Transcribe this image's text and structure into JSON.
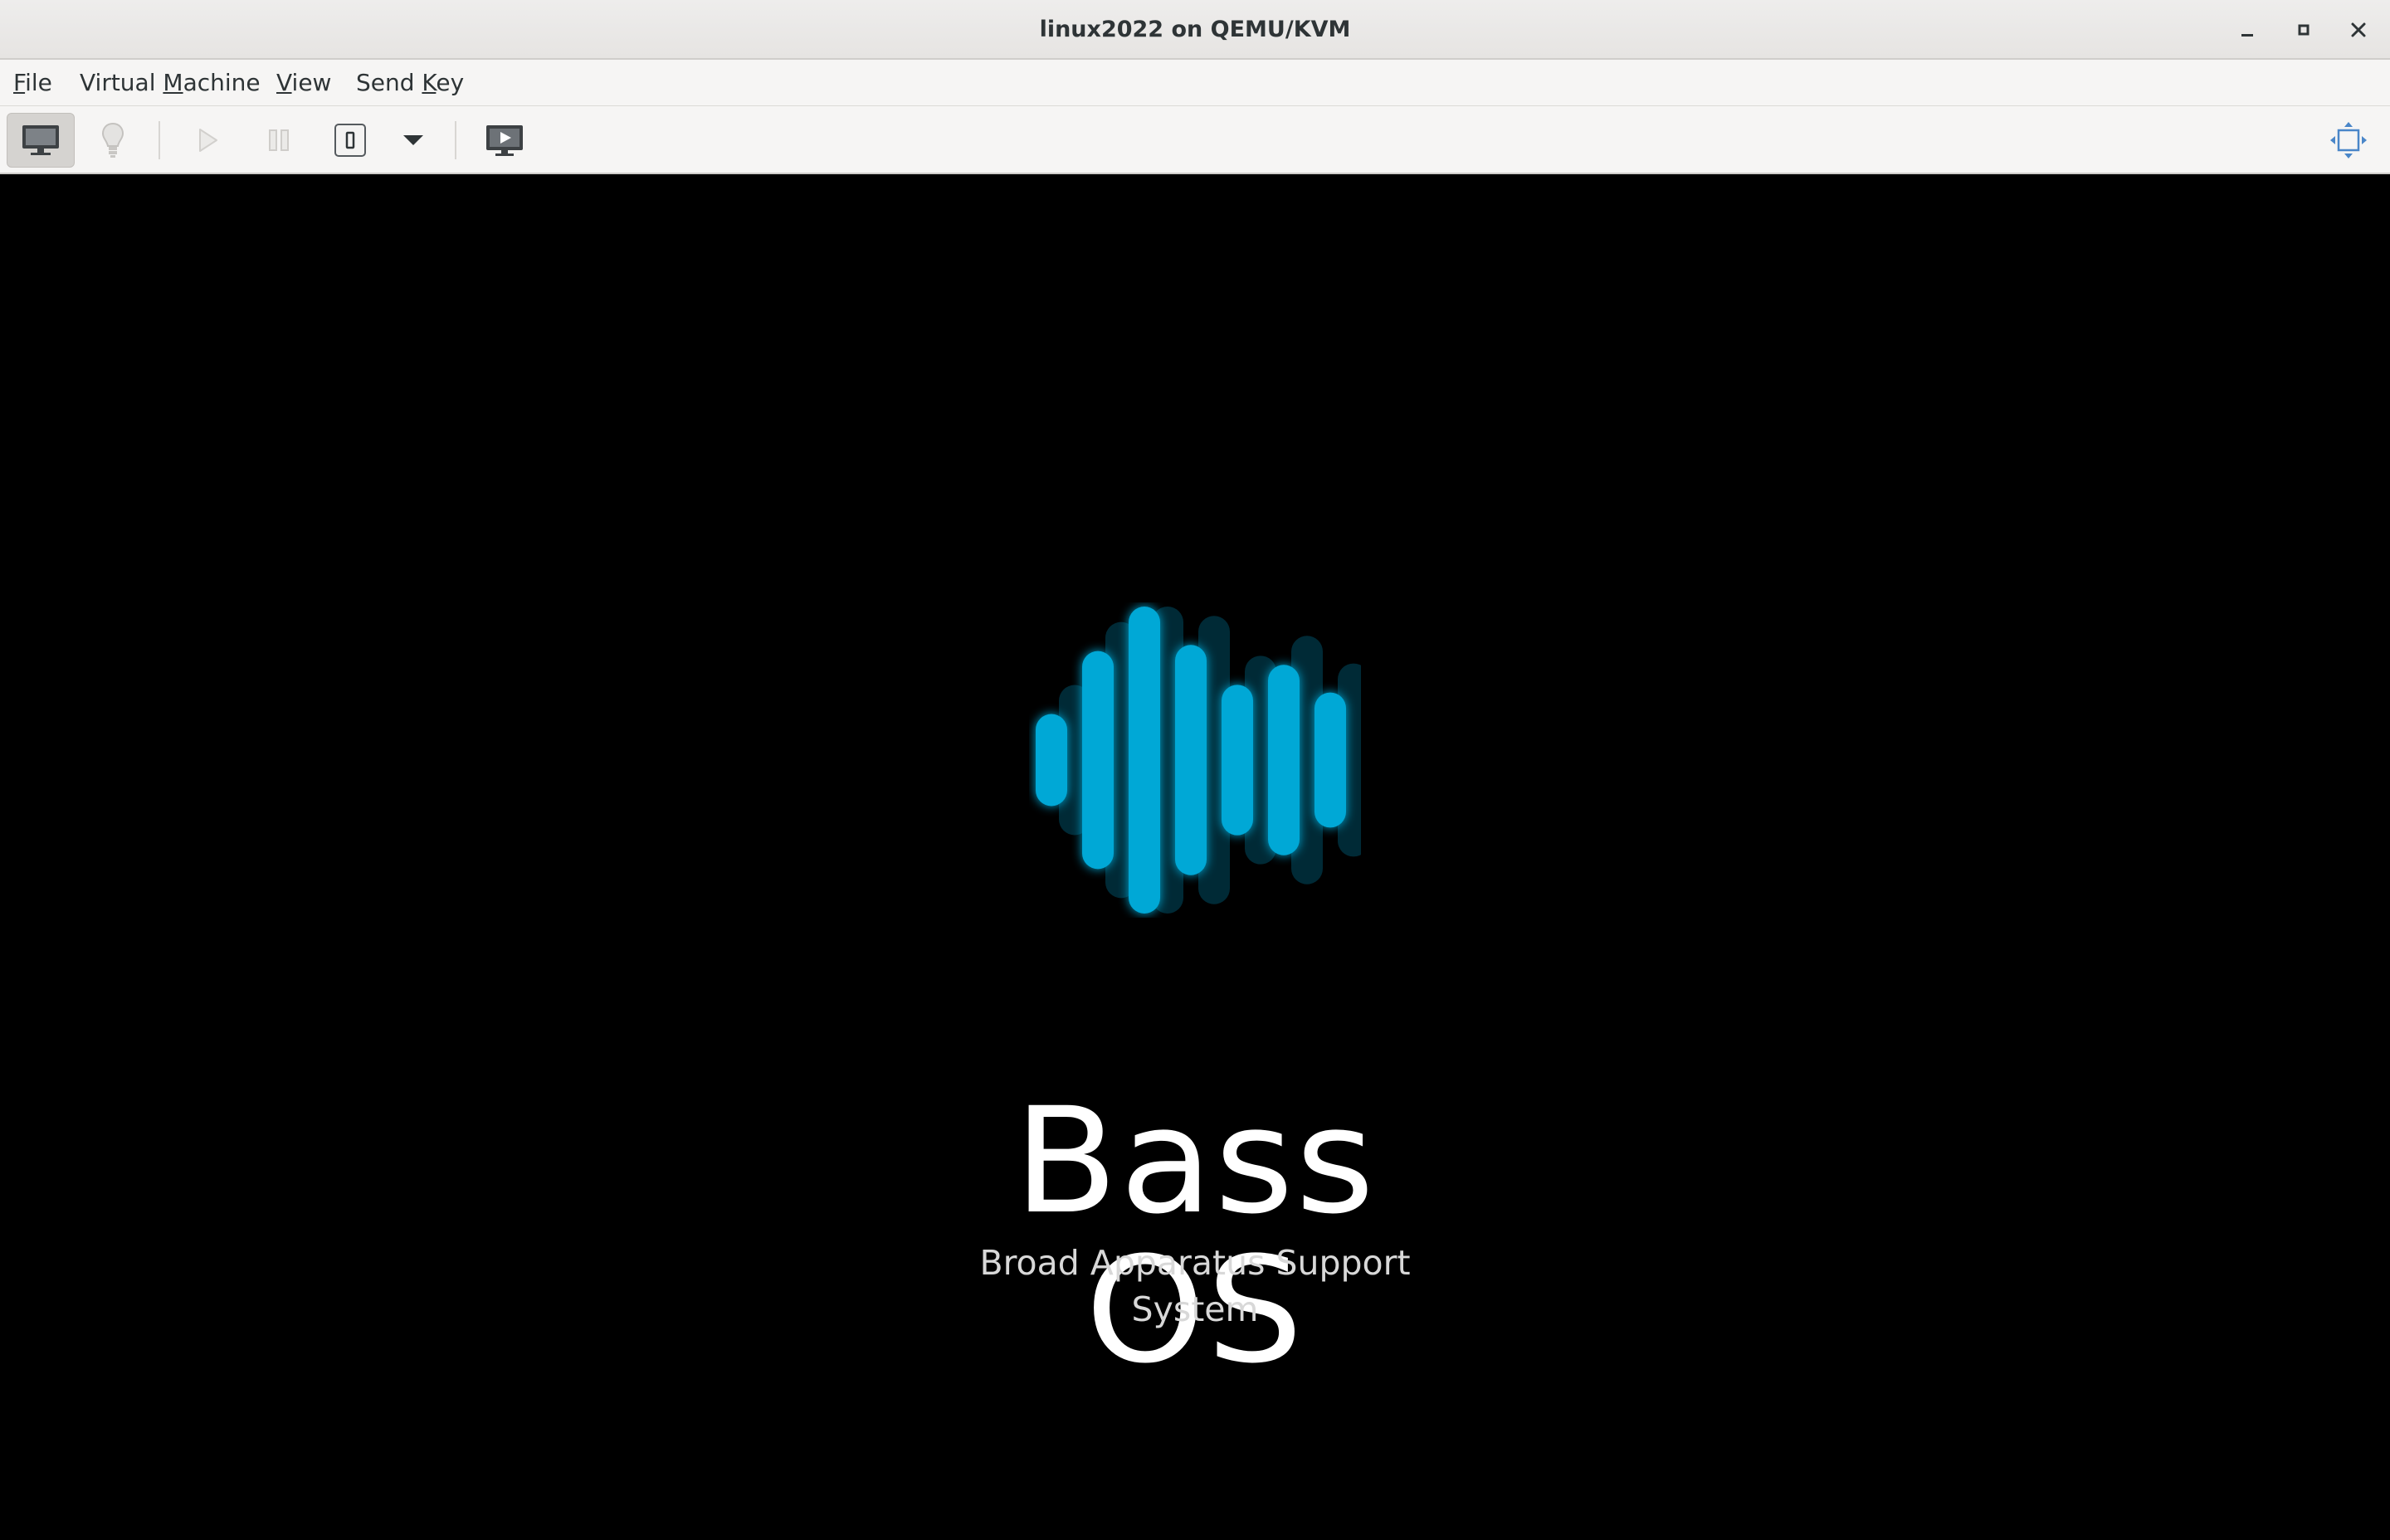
{
  "window": {
    "title": "linux2022 on QEMU/KVM"
  },
  "menubar": {
    "items": [
      {
        "label_pre": "",
        "mnemonic": "F",
        "label_post": "ile"
      },
      {
        "label_pre": "Virtual ",
        "mnemonic": "M",
        "label_post": "achine"
      },
      {
        "label_pre": "",
        "mnemonic": "V",
        "label_post": "iew"
      },
      {
        "label_pre": "Send ",
        "mnemonic": "K",
        "label_post": "ey"
      }
    ]
  },
  "toolbar": {
    "icons": {
      "console": "monitor-icon",
      "details": "lightbulb-icon",
      "run": "play-icon",
      "pause": "pause-icon",
      "shutdown": "power-icon",
      "shutdown_menu": "chevron-down-icon",
      "snapshots": "snapshot-monitor-icon",
      "fullscreen": "fullscreen-icon"
    }
  },
  "console": {
    "logo": {
      "accent_color": "#00a8d6",
      "bar_levels": [
        0.3,
        0.71,
        1.0,
        0.75,
        0.49,
        0.62,
        0.44
      ]
    },
    "brand_title": "Bass OS",
    "brand_subtitle": "Broad Apparatus Support System"
  },
  "colors": {
    "titlebar_bg": "#e8e6e4",
    "toolbar_bg": "#f6f5f4",
    "console_bg": "#000000",
    "text": "#2e3436"
  }
}
